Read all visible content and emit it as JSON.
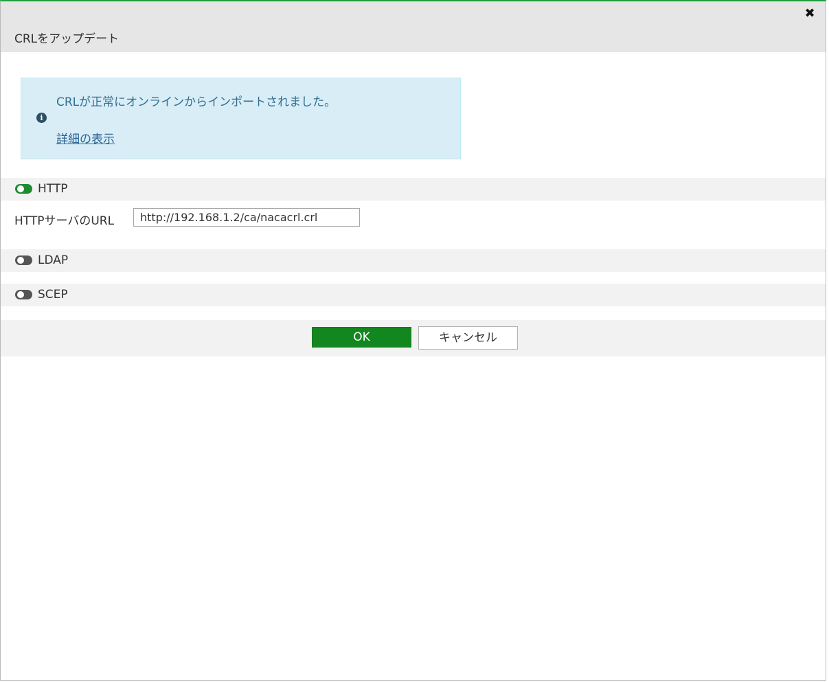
{
  "dialog": {
    "title": "CRLをアップデート",
    "close_glyph": "✖"
  },
  "alert": {
    "icon": "info-icon",
    "icon_glyph": "i",
    "message": "CRLが正常にオンラインからインポートされました。",
    "details_link": "詳細の表示"
  },
  "sections": [
    {
      "label": "HTTP",
      "enabled": true
    },
    {
      "label": "LDAP",
      "enabled": false
    },
    {
      "label": "SCEP",
      "enabled": false
    }
  ],
  "http": {
    "url_label": "HTTPサーバのURL",
    "url_value": "http://192.168.1.2/ca/nacacrl.crl"
  },
  "footer": {
    "ok_label": "OK",
    "cancel_label": "キャンセル"
  },
  "colors": {
    "accent_green": "#12861f",
    "toggle_on": "#1e8c2e",
    "toggle_off": "#555555",
    "alert_bg": "#d9edf7",
    "alert_text": "#31708f"
  }
}
